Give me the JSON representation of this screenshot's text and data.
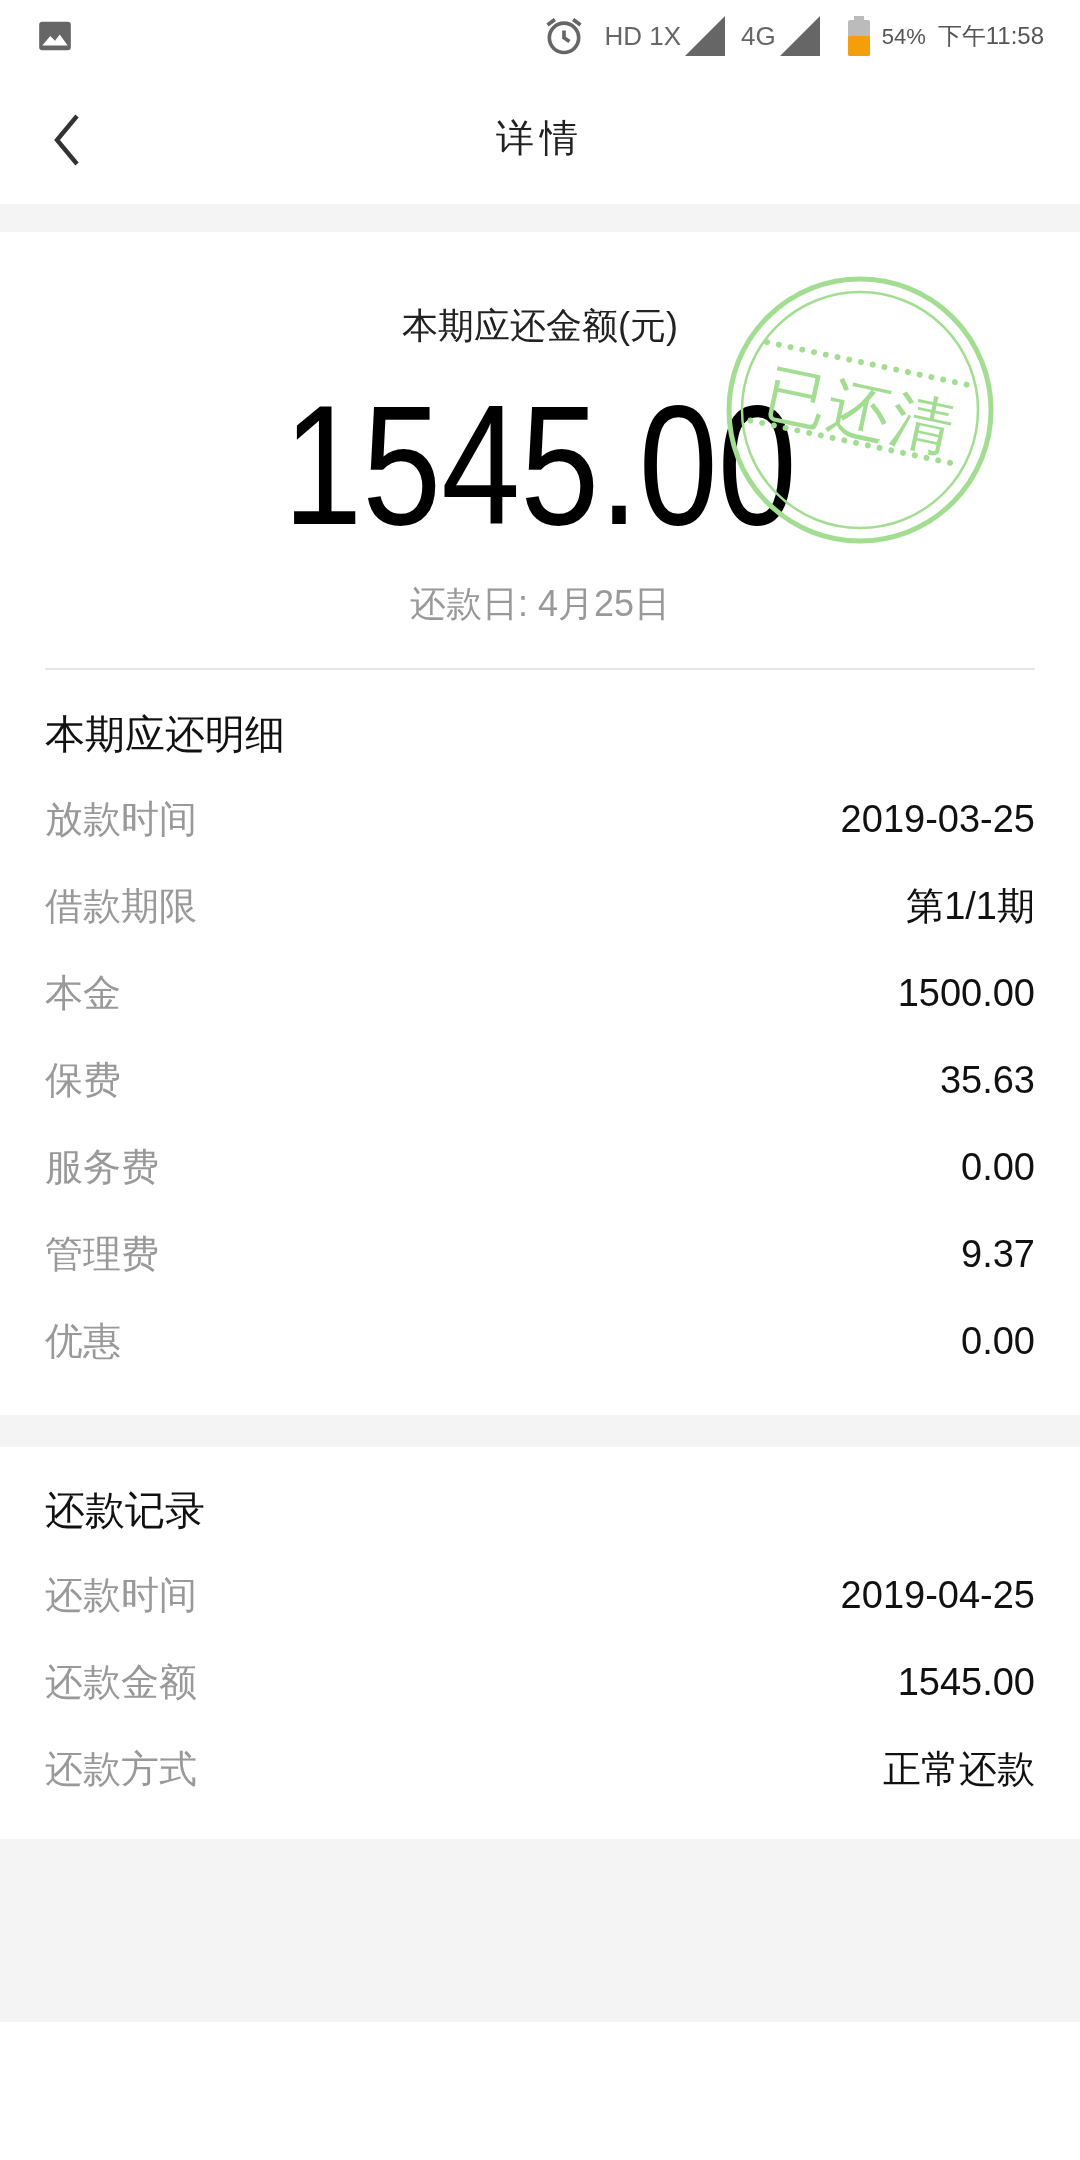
{
  "status_bar": {
    "network_labels": [
      "HD 1X",
      "4G"
    ],
    "battery": "54%",
    "time": "下午11:58"
  },
  "header": {
    "title": "详情"
  },
  "summary": {
    "label": "本期应还金额(元)",
    "amount": "1545.00",
    "due_date": "还款日: 4月25日",
    "stamp": "已还清"
  },
  "sections": [
    {
      "title": "本期应还明细",
      "rows": [
        {
          "label": "放款时间",
          "value": "2019-03-25"
        },
        {
          "label": "借款期限",
          "value": "第1/1期"
        },
        {
          "label": "本金",
          "value": "1500.00"
        },
        {
          "label": "保费",
          "value": "35.63"
        },
        {
          "label": "服务费",
          "value": "0.00"
        },
        {
          "label": "管理费",
          "value": "9.37"
        },
        {
          "label": "优惠",
          "value": "0.00"
        }
      ]
    },
    {
      "title": "还款记录",
      "rows": [
        {
          "label": "还款时间",
          "value": "2019-04-25"
        },
        {
          "label": "还款金额",
          "value": "1545.00"
        },
        {
          "label": "还款方式",
          "value": "正常还款"
        }
      ]
    }
  ]
}
